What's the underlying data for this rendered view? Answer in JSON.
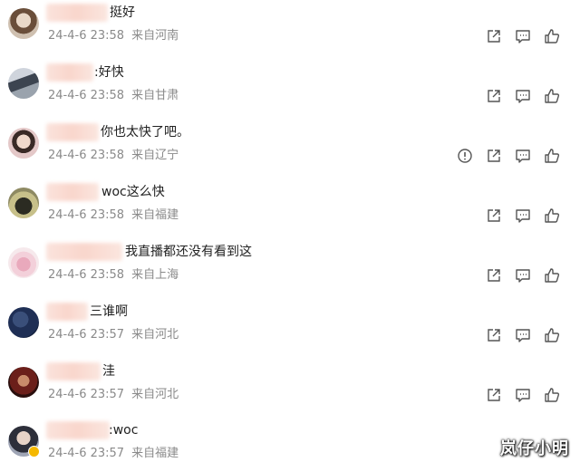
{
  "comments": [
    {
      "text": "挺好",
      "time": "24-4-6 23:58",
      "location": "来自河南",
      "warn": false
    },
    {
      "text": ":好快",
      "time": "24-4-6 23:58",
      "location": "来自甘肃",
      "warn": false
    },
    {
      "text": "你也太快了吧。",
      "time": "24-4-6 23:58",
      "location": "来自辽宁",
      "warn": true
    },
    {
      "text": "woc这么快",
      "time": "24-4-6 23:58",
      "location": "来自福建",
      "warn": false
    },
    {
      "text": "我直播都还没有看到这",
      "time": "24-4-6 23:58",
      "location": "来自上海",
      "warn": false
    },
    {
      "text": "三谁啊",
      "time": "24-4-6 23:57",
      "location": "来自河北",
      "warn": false
    },
    {
      "text": "洼",
      "time": "24-4-6 23:57",
      "location": "来自河北",
      "warn": false
    },
    {
      "text": ":woc",
      "time": "24-4-6 23:57",
      "location": "来自福建",
      "warn": false
    }
  ],
  "icons": [
    "share-icon",
    "comment-icon",
    "like-icon",
    "report-icon"
  ],
  "watermark": "岚仔小明",
  "colors": {
    "meta": "#8a8a8a",
    "icon": "#555555",
    "name_blur": "#f9d6cc"
  }
}
